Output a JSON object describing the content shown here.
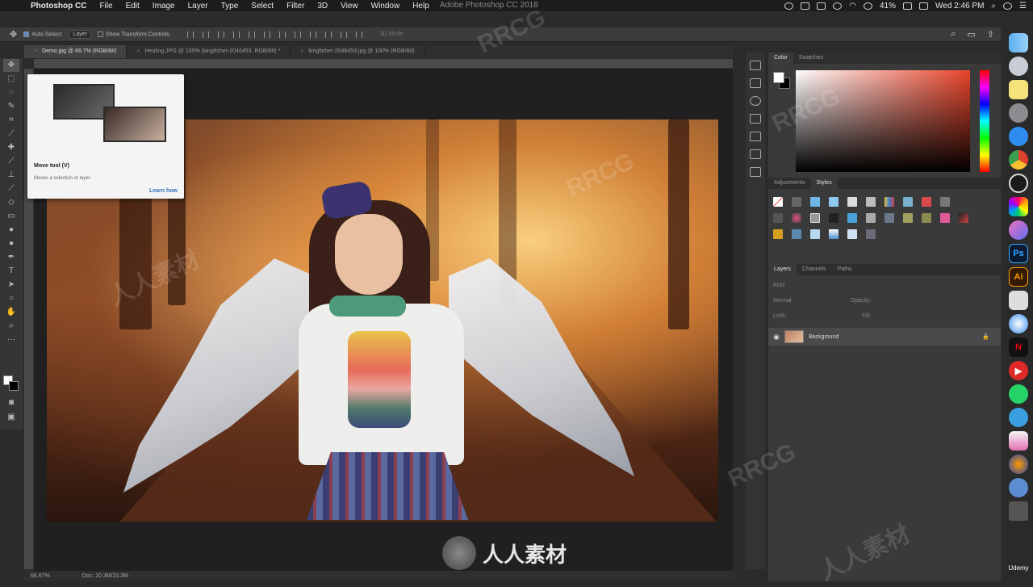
{
  "menubar": {
    "app_name": "Photoshop CC",
    "items": [
      "File",
      "Edit",
      "Image",
      "Layer",
      "Type",
      "Select",
      "Filter",
      "3D",
      "View",
      "Window",
      "Help"
    ],
    "window_title": "Adobe Photoshop CC 2018",
    "battery": "41%",
    "clock": "Wed 2:46 PM"
  },
  "options": {
    "auto_select_label": "Auto-Select:",
    "auto_select_target": "Layer",
    "transform_label": "Show Transform Controls",
    "mode_3d": "3D Mode:"
  },
  "tabs": [
    {
      "label": "Demo.jpg @ 66.7% (RGB/8#)"
    },
    {
      "label": "Healing.JPG @ 100% (kingfisher-2046453, RGB/8#) *"
    },
    {
      "label": "kingfisher-2046453.jpg @ 100% (RGB/8#)"
    }
  ],
  "tooltip": {
    "title": "Move tool (V)",
    "description": "Moves a selection or layer",
    "link": "Learn how"
  },
  "status": {
    "zoom": "66.67%",
    "doc": "Doc: 20.3M/20.3M"
  },
  "panels": {
    "color_tabs": [
      "Color",
      "Swatches"
    ],
    "style_tabs": [
      "Adjustments",
      "Styles"
    ],
    "layer_tabs": [
      "Layers",
      "Channels",
      "Paths"
    ],
    "layer_filter": "Kind",
    "blend_mode": "Normal",
    "opacity_label": "Opacity:",
    "lock_label": "Lock:",
    "fill_label": "Fill:",
    "layer_name": "Background"
  },
  "dock": {
    "label": "Udemy",
    "icons": [
      "finder-icon",
      "launchpad-icon",
      "notes-icon",
      "settings-icon",
      "appstore-icon",
      "chrome-icon",
      "obs-icon",
      "photos-icon",
      "itunes-icon",
      "photoshop-icon",
      "illustrator-icon",
      "screenshot-icon",
      "safari-icon",
      "netflix-icon",
      "youtube-icon",
      "whatsapp-icon",
      "telegram-icon",
      "keynote-icon",
      "firefox-icon",
      "network-icon",
      "trash-icon"
    ],
    "ps_label": "Ps",
    "ai_label": "Ai"
  },
  "watermark": {
    "text": "RRCG",
    "cn_text": "人人素材"
  },
  "colors": {
    "accent": "#2f6fc2",
    "ps_blue": "#31a8ff",
    "ai_orange": "#ff9a00"
  }
}
